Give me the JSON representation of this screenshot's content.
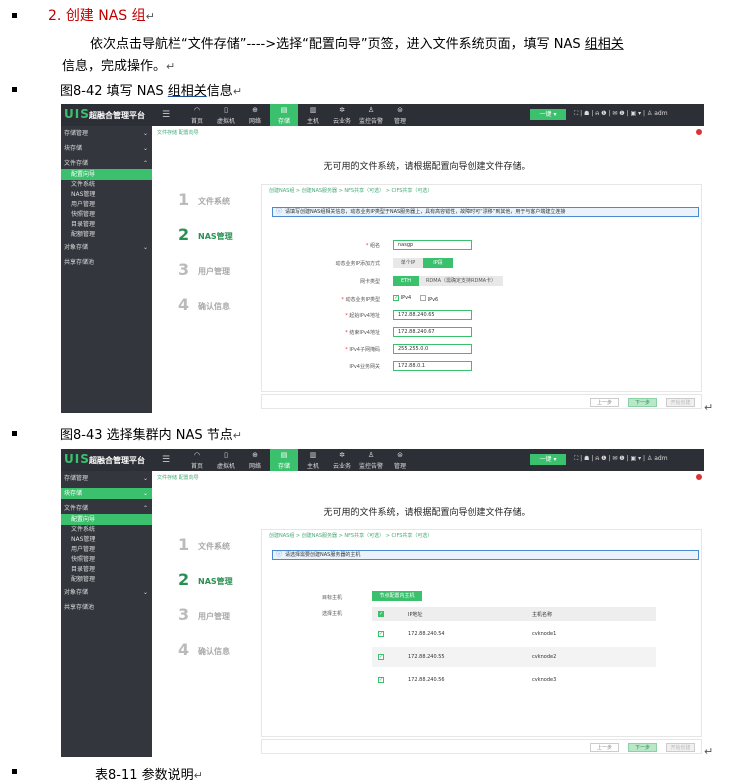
{
  "heading": {
    "number": "2.",
    "text": "创建 NAS 组"
  },
  "para": {
    "line1": "依次点击导航栏“文件存储”---->选择“配置向导”页签，进入文件系统页面，填写 NAS ",
    "line1_ul": "组相关",
    "line2": "信息，完成操作。"
  },
  "fig42": {
    "caption_pre": "图8-42 填写 NAS ",
    "caption_ul": "组相关",
    "caption_post": "信息"
  },
  "fig43": {
    "caption": "图8-43 选择集群内 NAS 节点"
  },
  "bottom_text": "表8-11 参数说明",
  "ui": {
    "logo_mark": "UIS",
    "logo_title": "超融合管理平台",
    "nav": [
      {
        "icon": "◠",
        "label": "首页"
      },
      {
        "icon": "▯",
        "label": "虚拟机"
      },
      {
        "icon": "⊕",
        "label": "网络"
      },
      {
        "icon": "▤",
        "label": "存储"
      },
      {
        "icon": "▥",
        "label": "主机"
      },
      {
        "icon": "✲",
        "label": "云业务"
      },
      {
        "icon": "♙",
        "label": "监控告警"
      },
      {
        "icon": "⊜",
        "label": "管理"
      }
    ],
    "onekey": "一键 ▾",
    "top_icons": "⛶ | ☗ | ⍾ ❶ | ✉ ❶ | ▣ ▾ | ♙ adm",
    "sidebar": [
      "存储管理",
      "块存储",
      "文件存储",
      "配置向导",
      "文件系统",
      "NAS管理",
      "用户管理",
      "快照管理",
      "目录管理",
      "配额管理",
      "对象存储",
      "共享存储池"
    ],
    "crumb": "文件存储  配置向导",
    "main_heading": "无可用的文件系统，请根据配置向导创建文件存储。",
    "steps": [
      {
        "n": "1",
        "label": "文件系统"
      },
      {
        "n": "2",
        "label": "NAS管理"
      },
      {
        "n": "3",
        "label": "用户管理"
      },
      {
        "n": "4",
        "label": "确认信息"
      }
    ],
    "panel_crumb": "创建NAS组 > 创建NAS服务器 > NFS共享（可选） > CIFS共享（可选）",
    "info1": "请填写创建NAS组相关信息，动态业务IP类型于NAS服务器上，具有高容错性，故障时可“漂移”到其他，用于与客户端建立连接",
    "info2": "请选择需要创建NAS服务器的主机",
    "form": {
      "group_name_label": "组名",
      "group_name_value": "nasgp",
      "ip_mode_label": "动态业务IP添加方式",
      "ip_mode_opts": [
        "单个IP",
        "IP段"
      ],
      "nic_label": "网卡类型",
      "nic_opts": [
        "ETH",
        "RDMA（需确定支持RDMA卡）"
      ],
      "ip_type_label": "动态业务IP类型",
      "ip_type_opts": [
        "IPv4",
        "IPv6"
      ],
      "start_label": "起始IPv4地址",
      "start_value": "172.88.240.65",
      "end_label": "结束IPv4地址",
      "end_value": "172.88.240.67",
      "mask_label": "IPv4子网掩码",
      "mask_value": "255.255.0.0",
      "gw_label": "IPv4业务网关",
      "gw_value": "172.88.0.1"
    },
    "footer": [
      "上一步",
      "下一步",
      "开始创建"
    ],
    "hosts": {
      "target_label": "目标主机",
      "target_button": "节点配置内主机",
      "select_label": "选择主机",
      "col_ip": "IP地址",
      "col_name": "主机名称",
      "rows": [
        {
          "ip": "172.88.240.54",
          "name": "cvknode1"
        },
        {
          "ip": "172.88.240.55",
          "name": "cvknode2"
        },
        {
          "ip": "172.88.240.56",
          "name": "cvknode3"
        }
      ]
    }
  }
}
